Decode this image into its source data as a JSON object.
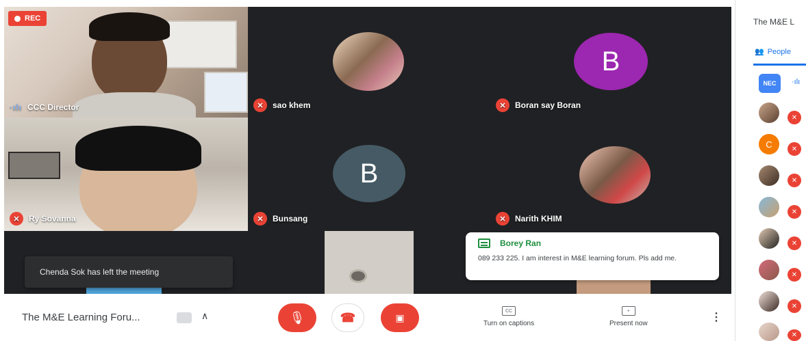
{
  "recording": {
    "label": "REC"
  },
  "tiles": [
    {
      "name": "CCC Director"
    },
    {
      "name": "sao khem"
    },
    {
      "name": "Boran say Boran",
      "initial": "B"
    },
    {
      "name": "Ry Sovanna"
    },
    {
      "name": "Bunsang",
      "initial": "B"
    },
    {
      "name": "Narith KHIM"
    }
  ],
  "toast": {
    "text": "Chenda Sok has left the meeting"
  },
  "chat": {
    "sender": "Borey Ran",
    "message": "089 233 225. I am interest in M&E learning forum. Pls add me."
  },
  "bottombar": {
    "meeting_title": "The M&E Learning Foru...",
    "captions_label": "Turn on captions",
    "captions_icon_text": "CC",
    "present_label": "Present now"
  },
  "panel": {
    "title": "The M&E L",
    "tab_people": "People",
    "badge_text": "NEC",
    "avatar_initial": "C"
  },
  "colors": {
    "accent_red": "#ea4335",
    "grid_bg": "#202124",
    "avatar_purple": "#9c27b0",
    "avatar_slate": "#455a64",
    "avatar_orange": "#f57c00",
    "link_blue": "#1a73e8",
    "chat_green": "#1e8e3e"
  },
  "icons": {
    "rec": "record-dot-icon",
    "mic_off": "mic-off-icon",
    "hangup": "hang-up-icon",
    "cam_off": "camera-off-icon",
    "captions": "captions-icon",
    "present": "present-screen-icon",
    "more": "more-vert-icon"
  }
}
